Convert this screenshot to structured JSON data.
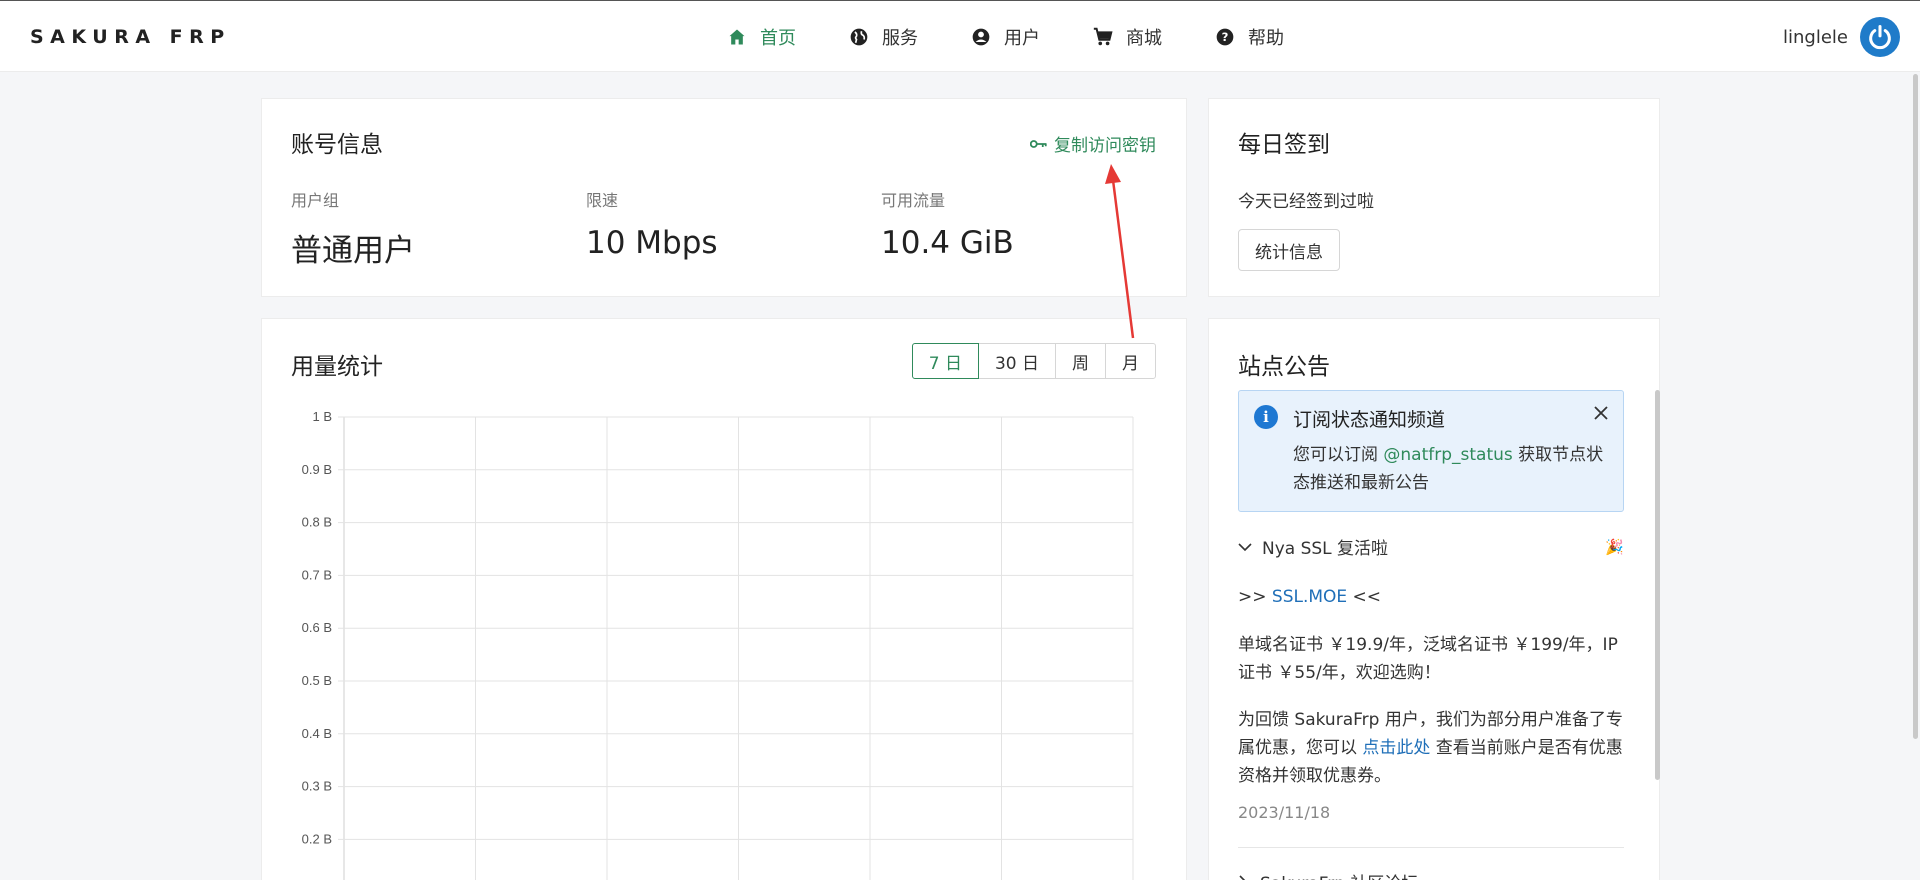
{
  "brand": "SAKURA FRP",
  "nav": [
    {
      "label": "首页",
      "icon": "home-icon",
      "active": true
    },
    {
      "label": "服务",
      "icon": "globe-icon",
      "active": false
    },
    {
      "label": "用户",
      "icon": "user-circle-icon",
      "active": false
    },
    {
      "label": "商城",
      "icon": "cart-icon",
      "active": false
    },
    {
      "label": "帮助",
      "icon": "help-icon",
      "active": false
    }
  ],
  "user": {
    "name": "linglele",
    "avatar_icon": "power-icon"
  },
  "account": {
    "title": "账号信息",
    "copy_key": "复制访问密钥",
    "stats": [
      {
        "label": "用户组",
        "value": "普通用户"
      },
      {
        "label": "限速",
        "value": "10 Mbps"
      },
      {
        "label": "可用流量",
        "value": "10.4 GiB"
      }
    ]
  },
  "daily": {
    "title": "每日签到",
    "status": "今天已经签到过啦",
    "button": "统计信息"
  },
  "usage": {
    "title": "用量统计",
    "ranges": [
      "7 日",
      "30 日",
      "周",
      "月"
    ],
    "active_range": "7 日"
  },
  "chart_data": {
    "type": "line",
    "title": "",
    "y_ticks": [
      "1 B",
      "0.9 B",
      "0.8 B",
      "0.7 B",
      "0.6 B",
      "0.5 B",
      "0.4 B",
      "0.3 B",
      "0.2 B"
    ],
    "ylim": [
      0,
      1
    ],
    "y_unit": "B",
    "grid": true,
    "series": []
  },
  "notice": {
    "title": "站点公告",
    "alert": {
      "title": "订阅状态通知频道",
      "body_prefix": "您可以订阅 ",
      "link": "@natfrp_status",
      "body_suffix": " 获取节点状态推送和最新公告"
    },
    "item1": {
      "title": "Nya SSL 复活啦",
      "emoji": "🎉",
      "line1_prefix": ">> ",
      "line1_link": "SSL.MOE",
      "line1_suffix": " <<",
      "line2": "单域名证书 ￥19.9/年，泛域名证书 ￥199/年，IP 证书 ￥55/年，欢迎选购！",
      "line3_prefix": "为回馈 SakuraFrp 用户，我们为部分用户准备了专属优惠，您可以 ",
      "line3_link": "点击此处",
      "line3_suffix": " 查看当前账户是否有优惠资格并领取优惠券。",
      "date": "2023/11/18"
    },
    "item2": {
      "title": "SakuraFrp 社区论坛"
    }
  },
  "colors": {
    "accent": "#2f8a5b",
    "link": "#1f6fb8",
    "avatar": "#1f7bc9",
    "annotation_arrow": "#e53935"
  }
}
